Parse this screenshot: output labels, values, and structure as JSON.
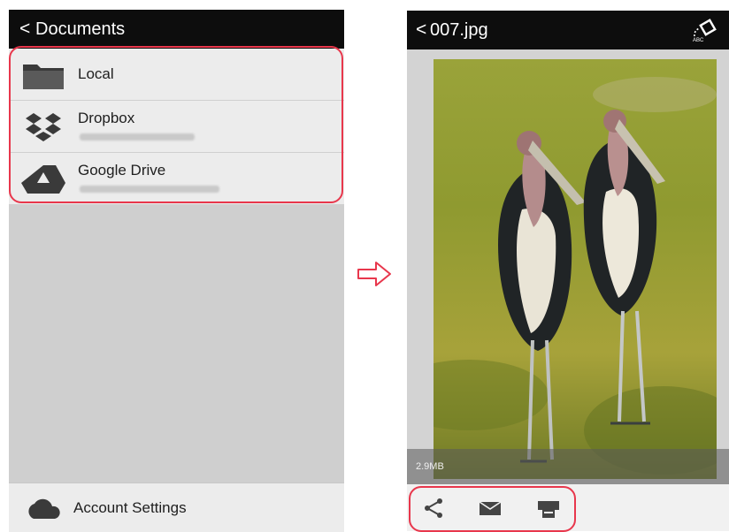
{
  "left_screen": {
    "header": {
      "back_glyph": "<",
      "title": "Documents"
    },
    "sources": [
      {
        "label": "Local",
        "icon": "folder-icon"
      },
      {
        "label": "Dropbox",
        "icon": "dropbox-icon"
      },
      {
        "label": "Google Drive",
        "icon": "google-drive-icon"
      }
    ],
    "footer": {
      "label": "Account Settings",
      "icon": "cloud-icon"
    }
  },
  "right_screen": {
    "header": {
      "back_glyph": "<",
      "title": "007.jpg",
      "action_icon": "rotate-icon"
    },
    "image": {
      "size_label": "2.9MB"
    },
    "actions": [
      "share-icon",
      "mail-icon",
      "print-icon"
    ]
  },
  "colors": {
    "highlight": "#e8374c",
    "header_bg": "#0d0d0d",
    "list_bg": "#ececec"
  }
}
